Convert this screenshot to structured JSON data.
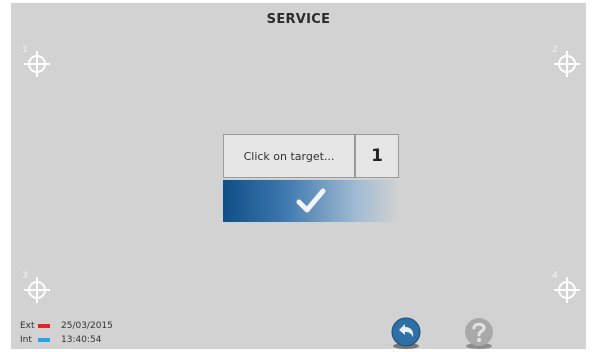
{
  "screen": {
    "title": "SERVICE"
  },
  "targets": [
    {
      "number": "1"
    },
    {
      "number": "2"
    },
    {
      "number": "3"
    },
    {
      "number": "4"
    }
  ],
  "calibration": {
    "prompt": "Click on target...",
    "counter": "1",
    "confirm_icon": "checkmark-icon"
  },
  "status": {
    "ext_label": "Ext",
    "ext_color": "#e8222b",
    "int_label": "Int",
    "int_color": "#2aa4e6",
    "date": "25/03/2015",
    "time": "13:40:54"
  },
  "buttons": {
    "back_icon": "back-arrow-icon",
    "help_icon": "help-icon",
    "back_color": "#2f6fa8",
    "help_color": "#a9a9a9"
  }
}
